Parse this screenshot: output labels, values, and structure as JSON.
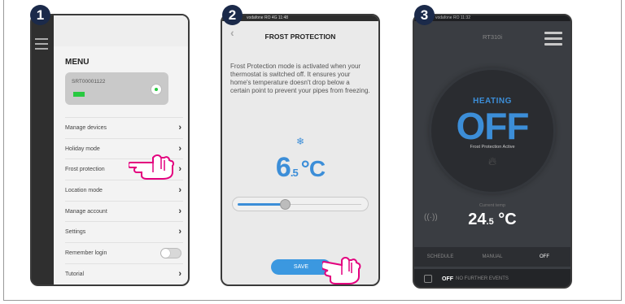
{
  "steps": [
    "1",
    "2",
    "3"
  ],
  "screen1": {
    "menu_title": "MENU",
    "device_serial": "SRT00001122",
    "items": [
      {
        "label": "Manage devices"
      },
      {
        "label": "Holiday mode"
      },
      {
        "label": "Frost protection"
      },
      {
        "label": "Location mode"
      },
      {
        "label": "Manage account"
      },
      {
        "label": "Settings"
      },
      {
        "label": "Remember login"
      },
      {
        "label": "Tutorial"
      }
    ],
    "remember_login_on": false
  },
  "screen2": {
    "status": "vodafone RO 4G 11:48",
    "title": "FROST PROTECTION",
    "description": "Frost Protection mode is activated when your thermostat is switched off. It ensures your home's temperature doesn't drop below a certain point to prevent your pipes from freezing.",
    "temp_int": "6",
    "temp_dec": ".5",
    "temp_unit": "°C",
    "slider_fraction": 0.35,
    "save_label": "SAVE"
  },
  "screen3": {
    "status": "vodafone RO 11:32",
    "model": "RT310i",
    "mode_label": "HEATING",
    "state": "OFF",
    "sub_state": "Frost Protection Active",
    "current_label": "Current temp",
    "current_int": "24",
    "current_dec": ".5",
    "current_unit": "°C",
    "tabs": [
      "SCHEDULE",
      "MANUAL",
      "OFF"
    ],
    "active_tab": "OFF",
    "footer_state": "OFF",
    "footer_text": "NO FURTHER EVENTS"
  },
  "colors": {
    "accent": "#3c8ed8",
    "pointer": "#e3007e",
    "badge": "#1b2a4a"
  }
}
